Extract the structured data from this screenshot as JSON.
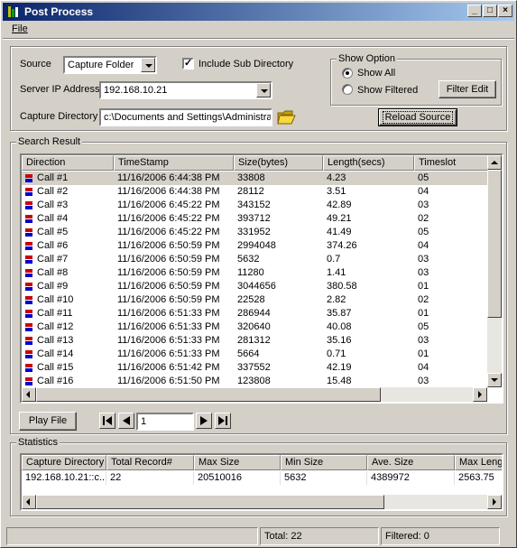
{
  "window": {
    "title": "Post Process"
  },
  "menu": {
    "file_label": "File"
  },
  "source": {
    "source_label": "Source",
    "source_value": "Capture Folder",
    "include_sub_label": "Include Sub Directory",
    "include_sub_checked": true,
    "server_ip_label": "Server IP Address",
    "server_ip_value": "192.168.10.21",
    "capture_dir_label": "Capture Directory",
    "capture_dir_value": "c:\\Documents and Settings\\Administrat",
    "show_option": {
      "legend": "Show Option",
      "show_all_label": "Show All",
      "show_filtered_label": "Show Filtered",
      "selected": "show_all",
      "filter_edit_label": "Filter Edit"
    },
    "reload_label": "Reload Source"
  },
  "search_result": {
    "legend": "Search Result",
    "columns": [
      "Direction",
      "TimeStamp",
      "Size(bytes)",
      "Length(secs)",
      "Timeslot"
    ],
    "rows": [
      [
        "Call #1",
        "11/16/2006 6:44:38 PM",
        "33808",
        "4.23",
        "05"
      ],
      [
        "Call #2",
        "11/16/2006 6:44:38 PM",
        "28112",
        "3.51",
        "04"
      ],
      [
        "Call #3",
        "11/16/2006 6:45:22 PM",
        "343152",
        "42.89",
        "03"
      ],
      [
        "Call #4",
        "11/16/2006 6:45:22 PM",
        "393712",
        "49.21",
        "02"
      ],
      [
        "Call #5",
        "11/16/2006 6:45:22 PM",
        "331952",
        "41.49",
        "05"
      ],
      [
        "Call #6",
        "11/16/2006 6:50:59 PM",
        "2994048",
        "374.26",
        "04"
      ],
      [
        "Call #7",
        "11/16/2006 6:50:59 PM",
        "5632",
        "0.7",
        "03"
      ],
      [
        "Call #8",
        "11/16/2006 6:50:59 PM",
        "11280",
        "1.41",
        "03"
      ],
      [
        "Call #9",
        "11/16/2006 6:50:59 PM",
        "3044656",
        "380.58",
        "01"
      ],
      [
        "Call #10",
        "11/16/2006 6:50:59 PM",
        "22528",
        "2.82",
        "02"
      ],
      [
        "Call #11",
        "11/16/2006 6:51:33 PM",
        "286944",
        "35.87",
        "01"
      ],
      [
        "Call #12",
        "11/16/2006 6:51:33 PM",
        "320640",
        "40.08",
        "05"
      ],
      [
        "Call #13",
        "11/16/2006 6:51:33 PM",
        "281312",
        "35.16",
        "03"
      ],
      [
        "Call #14",
        "11/16/2006 6:51:33 PM",
        "5664",
        "0.71",
        "01"
      ],
      [
        "Call #15",
        "11/16/2006 6:51:42 PM",
        "337552",
        "42.19",
        "04"
      ],
      [
        "Call #16",
        "11/16/2006 6:51:50 PM",
        "123808",
        "15.48",
        "03"
      ]
    ],
    "selected_row": 0,
    "play_label": "Play File",
    "page_value": "1"
  },
  "statistics": {
    "legend": "Statistics",
    "columns": [
      "Capture Directory",
      "Total Record#",
      "Max Size",
      "Min Size",
      "Ave. Size",
      "Max Leng"
    ],
    "row": [
      "192.168.10.21::c...",
      "22",
      "20510016",
      "5632",
      "4389972",
      "2563.75"
    ]
  },
  "status": {
    "total": "Total: 22",
    "filtered": "Filtered: 0"
  },
  "colors": {
    "title_start": "#0a246a",
    "title_end": "#a6caf0",
    "face": "#d4d0c8",
    "call_icon_red": "#cc0000",
    "call_icon_blue": "#0000cc"
  }
}
